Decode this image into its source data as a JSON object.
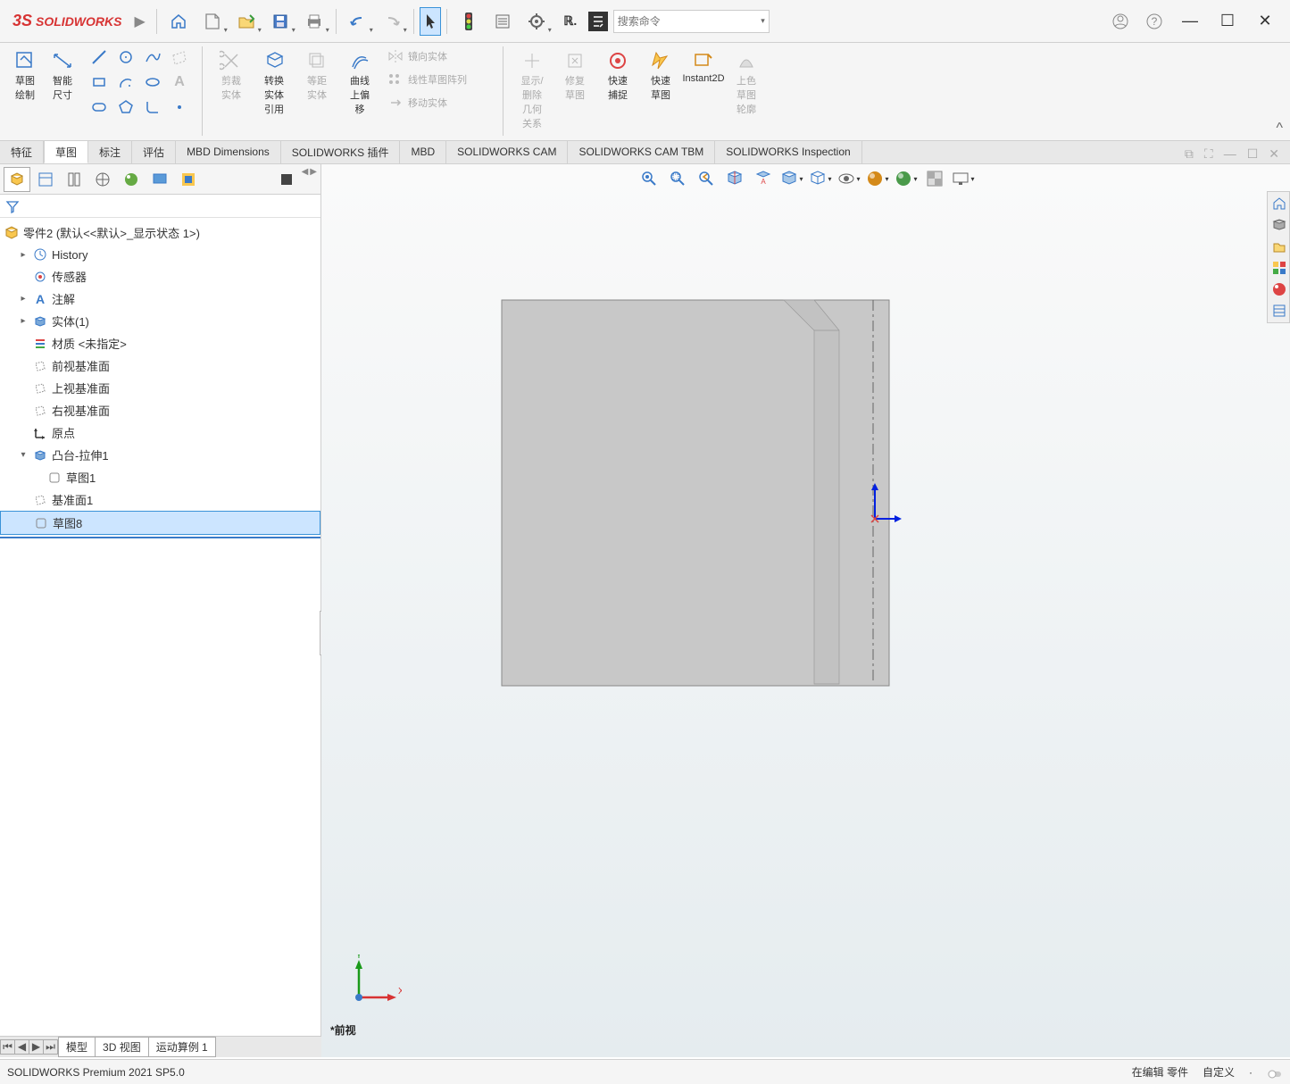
{
  "app": {
    "name": "SOLIDWORKS"
  },
  "search": {
    "placeholder": "搜索命令"
  },
  "ribbon": {
    "sketch": "草图绘制",
    "smartdim": "智能尺寸",
    "trim": "剪裁实体",
    "trim2": "剪",
    "convert": "转换实体引用",
    "offset": "等距实体",
    "curve": "曲线上偏移",
    "mirror": "镜向实体",
    "pattern": "线性草图阵列",
    "move": "移动实体",
    "showdel": "显示/删除几何关系",
    "repair": "修复草图",
    "snap": "快速捕捉",
    "rapid": "快速草图",
    "instant": "Instant2D",
    "shade": "上色草图轮廓"
  },
  "tabs": [
    "特征",
    "草图",
    "标注",
    "评估",
    "MBD Dimensions",
    "SOLIDWORKS 插件",
    "MBD",
    "SOLIDWORKS CAM",
    "SOLIDWORKS CAM TBM",
    "SOLIDWORKS Inspection"
  ],
  "tree": {
    "root": "零件2 (默认<<默认>_显示状态 1>)",
    "history": "History",
    "sensors": "传感器",
    "annot": "注解",
    "bodies": "实体(1)",
    "material": "材质 <未指定>",
    "front": "前视基准面",
    "top": "上视基准面",
    "right": "右视基准面",
    "origin": "原点",
    "extrude": "凸台-拉伸1",
    "sketch1": "草图1",
    "plane1": "基准面1",
    "sketch8": "草图8"
  },
  "bottom_tabs": [
    "模型",
    "3D 视图",
    "运动算例 1"
  ],
  "view_label": "*前视",
  "status": {
    "version": "SOLIDWORKS Premium 2021 SP5.0",
    "mode": "在编辑 零件",
    "units": "自定义",
    "dot": "·"
  },
  "triad": {
    "x": "X",
    "y": "Y"
  }
}
